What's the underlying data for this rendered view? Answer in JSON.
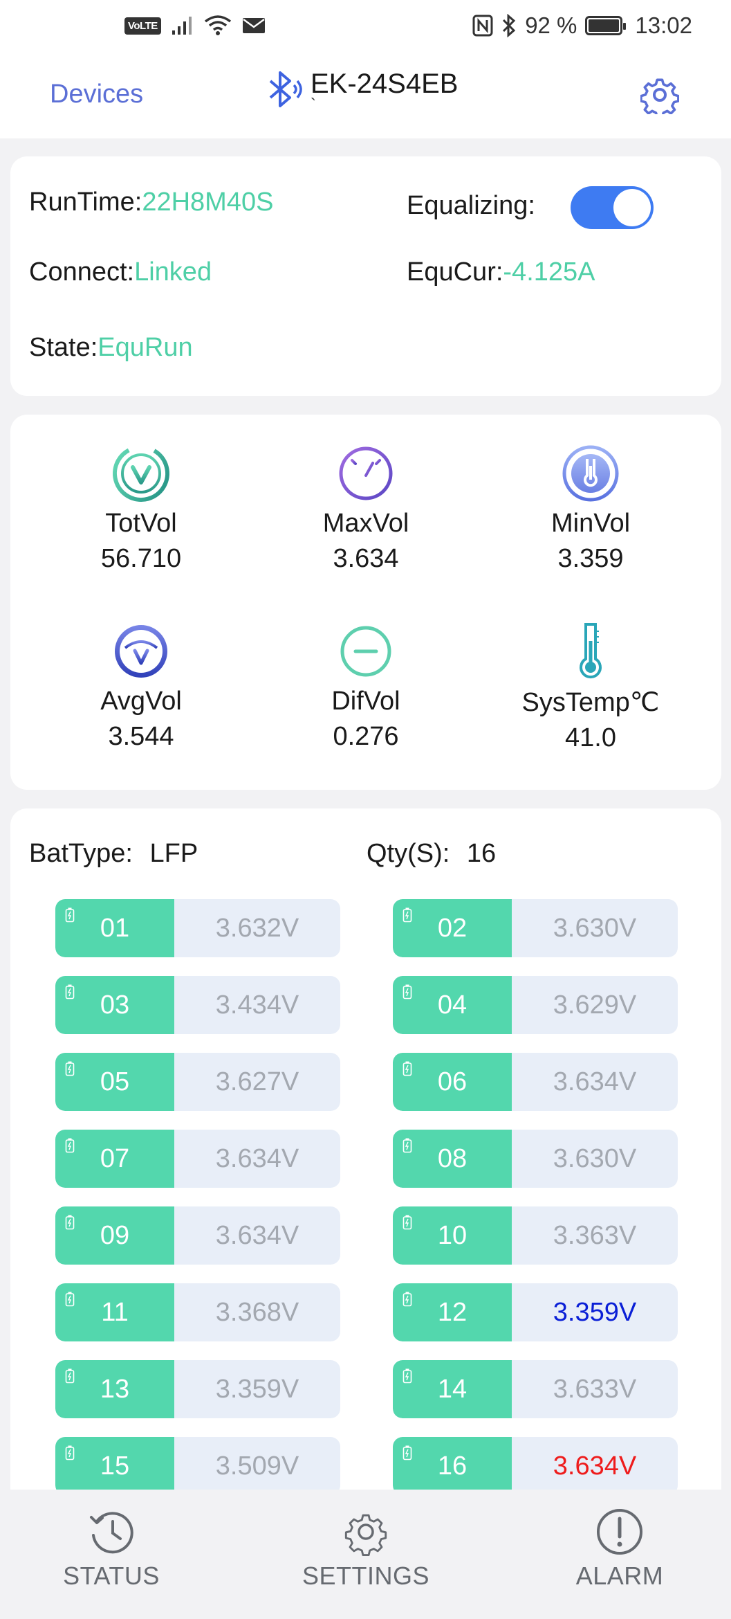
{
  "status_bar": {
    "volte": "VoLTE",
    "battery_percent": "92 %",
    "time": "13:02"
  },
  "header": {
    "back_label": "Devices",
    "device_name": "EK-24S4EB",
    "subtitle_mark": "`",
    "icons": [
      "bluetooth-icon",
      "gear-icon"
    ]
  },
  "info": {
    "runtime_label": "RunTime:",
    "runtime_value": "22H8M40S",
    "equalizing_label": "Equalizing:",
    "equalizing_on": true,
    "connect_label": "Connect:",
    "connect_value": "Linked",
    "equcur_label": "EquCur:",
    "equcur_value": "-4.125A",
    "state_label": "State:",
    "state_value": "EquRun"
  },
  "metrics": [
    {
      "label": "TotVol",
      "value": "56.710",
      "icon": "check-circle-icon"
    },
    {
      "label": "MaxVol",
      "value": "3.634",
      "icon": "gauge-icon"
    },
    {
      "label": "MinVol",
      "value": "3.359",
      "icon": "min-thermo-icon"
    },
    {
      "label": "AvgVol",
      "value": "3.544",
      "icon": "avg-circle-icon"
    },
    {
      "label": "DifVol",
      "value": "0.276",
      "icon": "minus-circle-icon"
    },
    {
      "label": "SysTemp℃",
      "value": "41.0",
      "icon": "thermometer-icon"
    }
  ],
  "battery": {
    "type_label": "BatType:",
    "type_value": "LFP",
    "qty_label": "Qty(S):",
    "qty_value": "16",
    "cells": [
      {
        "num": "01",
        "volt": "3.632V"
      },
      {
        "num": "02",
        "volt": "3.630V"
      },
      {
        "num": "03",
        "volt": "3.434V"
      },
      {
        "num": "04",
        "volt": "3.629V"
      },
      {
        "num": "05",
        "volt": "3.627V"
      },
      {
        "num": "06",
        "volt": "3.634V"
      },
      {
        "num": "07",
        "volt": "3.634V"
      },
      {
        "num": "08",
        "volt": "3.630V"
      },
      {
        "num": "09",
        "volt": "3.634V"
      },
      {
        "num": "10",
        "volt": "3.363V"
      },
      {
        "num": "11",
        "volt": "3.368V"
      },
      {
        "num": "12",
        "volt": "3.359V"
      },
      {
        "num": "13",
        "volt": "3.359V"
      },
      {
        "num": "14",
        "volt": "3.633V"
      },
      {
        "num": "15",
        "volt": "3.509V"
      },
      {
        "num": "16",
        "volt": "3.634V"
      }
    ],
    "min_color": "#0a1fd6",
    "max_color": "#ee1c1c"
  },
  "nav": [
    {
      "label": "STATUS",
      "icon": "history-icon"
    },
    {
      "label": "SETTINGS",
      "icon": "gear-icon"
    },
    {
      "label": "ALARM",
      "icon": "alert-circle-icon"
    }
  ],
  "colors": {
    "accent_green": "#4ecfa6",
    "cell_green": "#53d7ad",
    "link_blue": "#5b6fd6",
    "toggle_blue": "#3e7bf2"
  }
}
